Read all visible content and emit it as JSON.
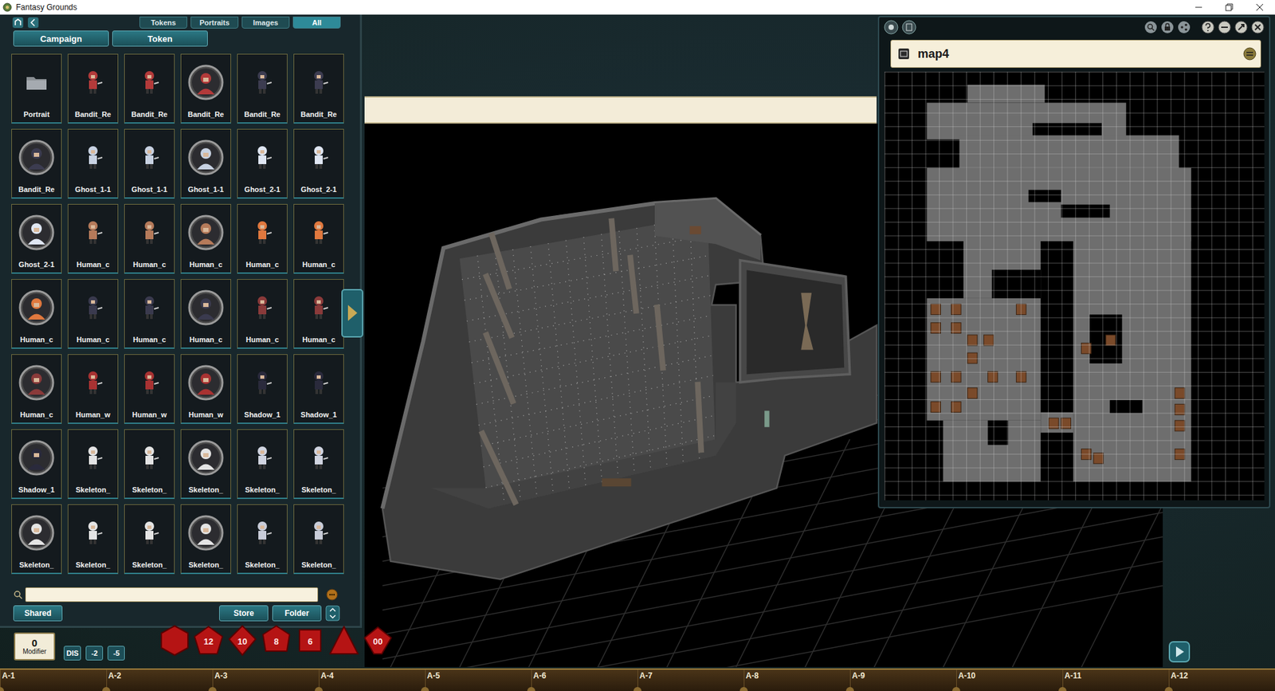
{
  "window": {
    "title": "Fantasy Grounds"
  },
  "assets": {
    "tabs": [
      {
        "label": "Tokens",
        "selected": false
      },
      {
        "label": "Portraits",
        "selected": false
      },
      {
        "label": "Images",
        "selected": false
      },
      {
        "label": "All",
        "selected": true
      }
    ],
    "filters": [
      "Campaign",
      "Token"
    ],
    "tokens": [
      {
        "label": "Portrait",
        "kind": "folder",
        "color": "#8a8f94"
      },
      {
        "label": "Bandit_Re",
        "kind": "sprite",
        "color": "#b33a3a"
      },
      {
        "label": "Bandit_Re",
        "kind": "sprite",
        "color": "#b33a3a"
      },
      {
        "label": "Bandit_Re",
        "kind": "round",
        "color": "#b33a3a"
      },
      {
        "label": "Bandit_Re",
        "kind": "sprite",
        "color": "#3c3c50"
      },
      {
        "label": "Bandit_Re",
        "kind": "sprite",
        "color": "#3c3c50"
      },
      {
        "label": "Bandit_Re",
        "kind": "round",
        "color": "#3c3c50"
      },
      {
        "label": "Ghost_1-1",
        "kind": "sprite",
        "color": "#c8d2e2"
      },
      {
        "label": "Ghost_1-1",
        "kind": "sprite",
        "color": "#c8d2e2"
      },
      {
        "label": "Ghost_1-1",
        "kind": "round",
        "color": "#c8d2e2"
      },
      {
        "label": "Ghost_2-1",
        "kind": "sprite",
        "color": "#dfe6f2"
      },
      {
        "label": "Ghost_2-1",
        "kind": "sprite",
        "color": "#dfe6f2"
      },
      {
        "label": "Ghost_2-1",
        "kind": "round",
        "color": "#dfe6f2"
      },
      {
        "label": "Human_c",
        "kind": "sprite",
        "color": "#b57a5a"
      },
      {
        "label": "Human_c",
        "kind": "sprite",
        "color": "#b57a5a"
      },
      {
        "label": "Human_c",
        "kind": "round",
        "color": "#b57a5a"
      },
      {
        "label": "Human_c",
        "kind": "sprite",
        "color": "#e0783e"
      },
      {
        "label": "Human_c",
        "kind": "sprite",
        "color": "#e0783e"
      },
      {
        "label": "Human_c",
        "kind": "round",
        "color": "#e0783e"
      },
      {
        "label": "Human_c",
        "kind": "sprite",
        "color": "#3a3a4e"
      },
      {
        "label": "Human_c",
        "kind": "sprite",
        "color": "#3a3a4e"
      },
      {
        "label": "Human_c",
        "kind": "round",
        "color": "#3a3a4e"
      },
      {
        "label": "Human_c",
        "kind": "sprite",
        "color": "#8a3a3a"
      },
      {
        "label": "Human_c",
        "kind": "sprite",
        "color": "#8a3a3a"
      },
      {
        "label": "Human_c",
        "kind": "round",
        "color": "#8a3a3a"
      },
      {
        "label": "Human_w",
        "kind": "sprite",
        "color": "#a83232"
      },
      {
        "label": "Human_w",
        "kind": "sprite",
        "color": "#a83232"
      },
      {
        "label": "Human_w",
        "kind": "round",
        "color": "#a83232"
      },
      {
        "label": "Shadow_1",
        "kind": "sprite",
        "color": "#2a2a3c"
      },
      {
        "label": "Shadow_1",
        "kind": "sprite",
        "color": "#2a2a3c"
      },
      {
        "label": "Shadow_1",
        "kind": "round",
        "color": "#2a2a3c"
      },
      {
        "label": "Skeleton_",
        "kind": "sprite",
        "color": "#e4e4e4"
      },
      {
        "label": "Skeleton_",
        "kind": "sprite",
        "color": "#e4e4e4"
      },
      {
        "label": "Skeleton_",
        "kind": "round",
        "color": "#e4e4e4"
      },
      {
        "label": "Skeleton_",
        "kind": "sprite",
        "color": "#d0d4e0"
      },
      {
        "label": "Skeleton_",
        "kind": "sprite",
        "color": "#d0d4e0"
      },
      {
        "label": "Skeleton_",
        "kind": "round",
        "color": "#e4e4e4"
      },
      {
        "label": "Skeleton_",
        "kind": "sprite",
        "color": "#e4e4e4"
      },
      {
        "label": "Skeleton_",
        "kind": "sprite",
        "color": "#e4e4e4"
      },
      {
        "label": "Skeleton_",
        "kind": "round",
        "color": "#e4e4e4"
      },
      {
        "label": "Skeleton_",
        "kind": "sprite",
        "color": "#c8ccd8"
      },
      {
        "label": "Skeleton_",
        "kind": "sprite",
        "color": "#c8ccd8"
      }
    ],
    "search": {
      "value": ""
    },
    "shared": "Shared",
    "right_buttons": [
      "Store",
      "Folder"
    ]
  },
  "map_window": {
    "title": "map4"
  },
  "modifier": {
    "value": "0",
    "label": "Modifier",
    "buttons": [
      "DIS",
      "-2",
      "-5"
    ]
  },
  "dice": [
    {
      "kind": "d20",
      "label": ""
    },
    {
      "kind": "d12",
      "label": "12"
    },
    {
      "kind": "d10",
      "label": "10"
    },
    {
      "kind": "d8",
      "label": "8"
    },
    {
      "kind": "d6",
      "label": "6"
    },
    {
      "kind": "d4",
      "label": ""
    },
    {
      "kind": "d100",
      "label": "00"
    }
  ],
  "hotkeys": [
    "A-1",
    "A-2",
    "A-3",
    "A-4",
    "A-5",
    "A-6",
    "A-7",
    "A-8",
    "A-9",
    "A-10",
    "A-11",
    "A-12"
  ]
}
